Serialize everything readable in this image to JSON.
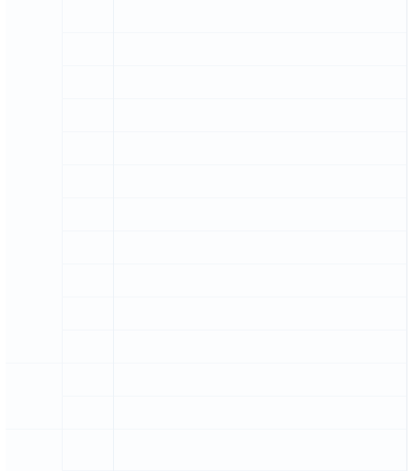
{
  "grid": {
    "rows": [
      [
        "",
        "",
        ""
      ],
      [
        "",
        "",
        ""
      ],
      [
        "",
        "",
        ""
      ],
      [
        "",
        "",
        ""
      ],
      [
        "",
        "",
        ""
      ],
      [
        "",
        "",
        ""
      ],
      [
        "",
        "",
        ""
      ],
      [
        "",
        "",
        ""
      ],
      [
        "",
        "",
        ""
      ],
      [
        "",
        "",
        ""
      ],
      [
        "",
        "",
        ""
      ],
      [
        "",
        "",
        ""
      ],
      [
        "",
        "",
        ""
      ],
      [
        "",
        "",
        ""
      ]
    ]
  }
}
